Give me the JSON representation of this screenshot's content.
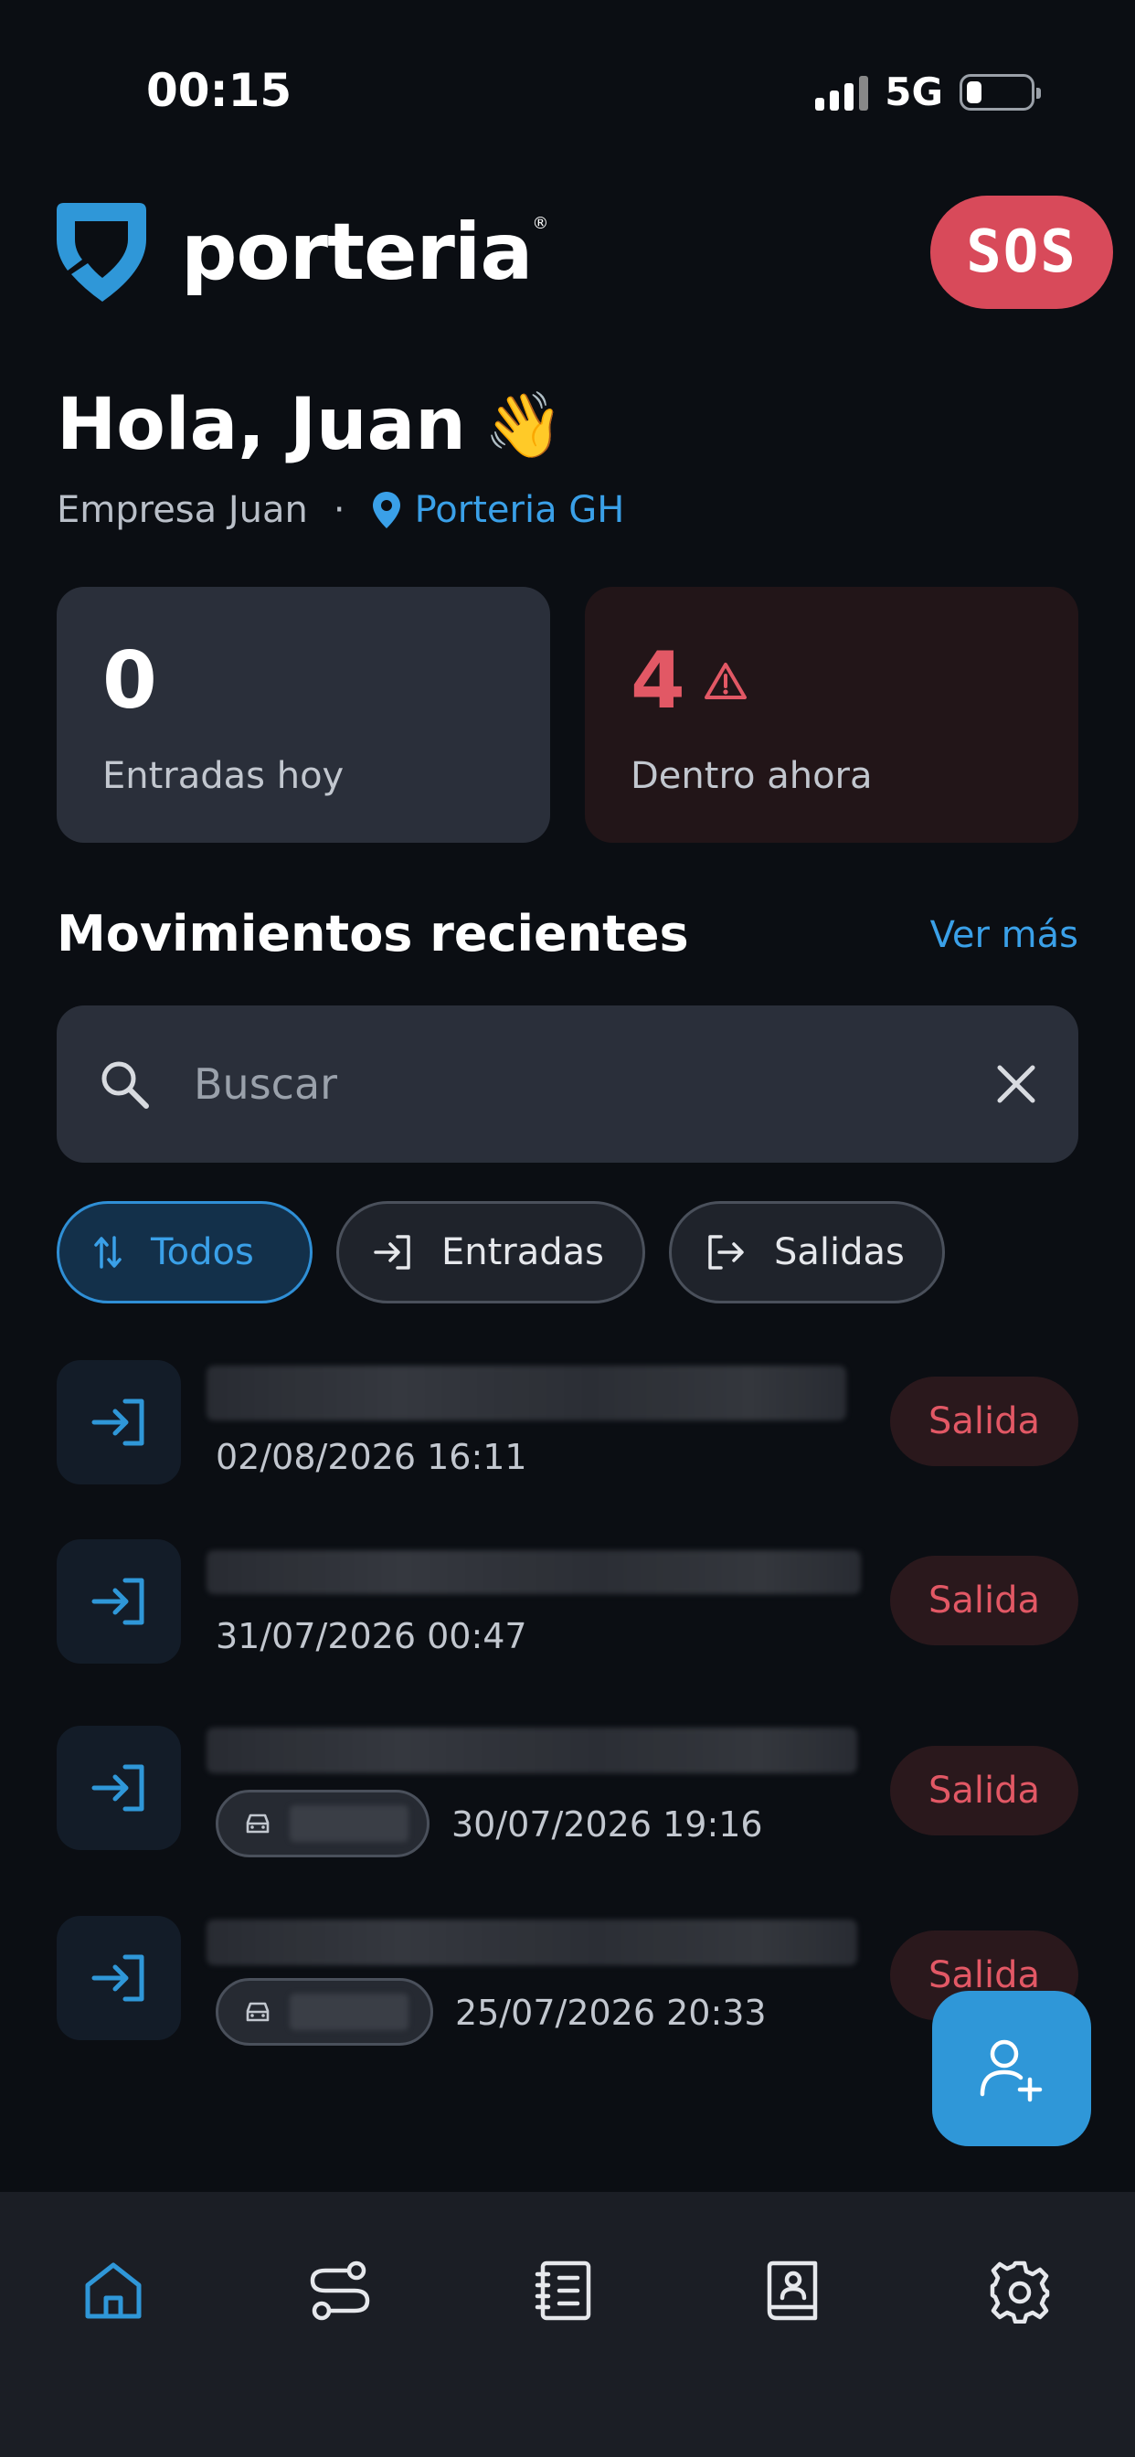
{
  "status_bar": {
    "time": "00:15",
    "network": "5G"
  },
  "brand": {
    "name": "porteria",
    "registered": "®",
    "accent": "#2f97d8"
  },
  "header": {
    "sos_label": "SOS"
  },
  "greeting": {
    "text": "Hola, Juan",
    "emoji": "👋",
    "company": "Empresa Juan",
    "separator": "·",
    "location": "Porteria GH"
  },
  "stats": [
    {
      "value": "0",
      "label": "Entradas hoy"
    },
    {
      "value": "4",
      "label": "Dentro ahora",
      "warning_icon": "alert-triangle-icon"
    }
  ],
  "movements": {
    "title": "Movimientos recientes",
    "see_more": "Ver más",
    "search_placeholder": "Buscar",
    "filters": [
      {
        "label": "Todos",
        "icon": "sort-arrows-icon",
        "active": true
      },
      {
        "label": "Entradas",
        "icon": "login-icon",
        "active": false
      },
      {
        "label": "Salidas",
        "icon": "logout-icon",
        "active": false
      }
    ],
    "items": [
      {
        "date": "02/08/2026 16:11",
        "status": "Salida",
        "vehicle": false
      },
      {
        "date": "31/07/2026 00:47",
        "status": "Salida",
        "vehicle": false
      },
      {
        "date": "30/07/2026 19:16",
        "status": "Salida",
        "vehicle": true
      },
      {
        "date": "25/07/2026 20:33",
        "status": "Salida",
        "vehicle": true
      }
    ]
  },
  "nav": [
    {
      "icon": "home-icon",
      "active": true
    },
    {
      "icon": "route-icon",
      "active": false
    },
    {
      "icon": "notebook-icon",
      "active": false
    },
    {
      "icon": "contacts-book-icon",
      "active": false
    },
    {
      "icon": "settings-gear-icon",
      "active": false
    }
  ],
  "colors": {
    "danger": "#e25865",
    "link": "#3aa0e8",
    "background": "#0b0e13"
  }
}
